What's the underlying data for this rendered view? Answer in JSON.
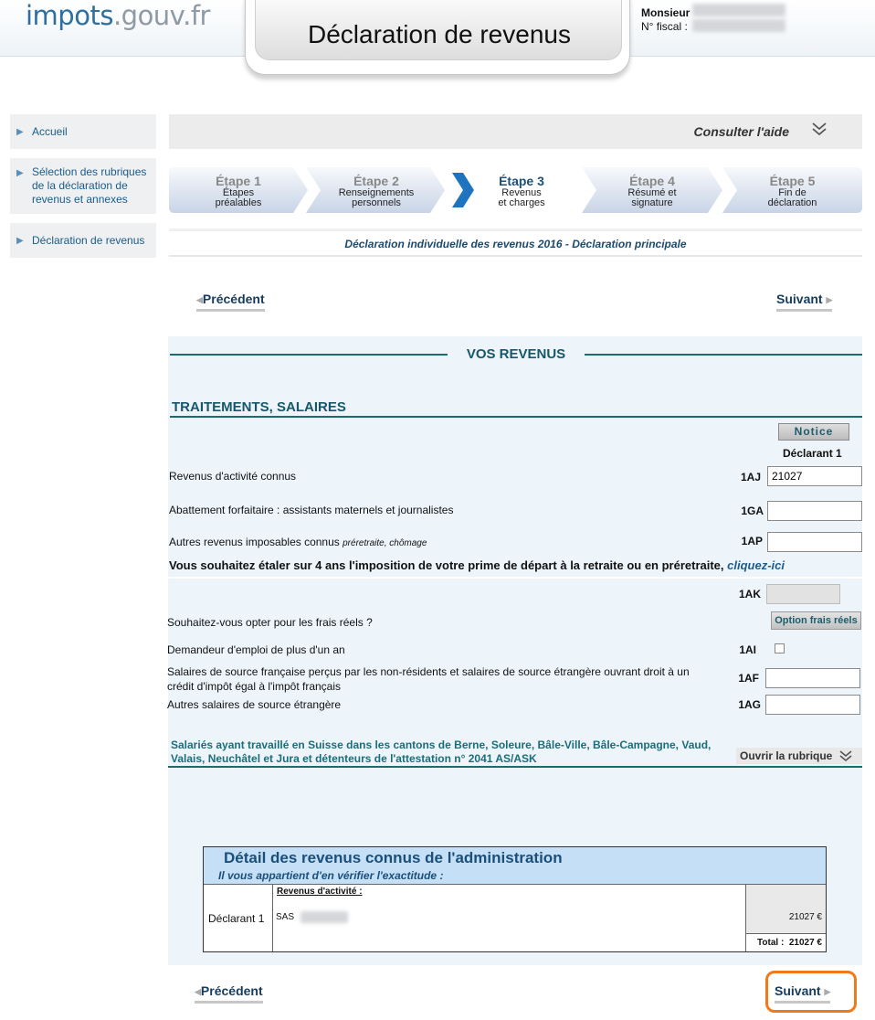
{
  "header": {
    "logo_part1": "impots",
    "logo_part2": ".gouv.fr",
    "page_title": "Déclaration de revenus",
    "user_title": "Monsieur",
    "fiscal_label": "N° fiscal :"
  },
  "sidebar": {
    "items": [
      {
        "label": "Accueil"
      },
      {
        "label": "Sélection des rubriques de la déclaration de revenus et annexes"
      },
      {
        "label": "Déclaration de revenus"
      }
    ]
  },
  "help": {
    "label": "Consulter l'aide",
    "icon": "double-chevron-down-icon"
  },
  "steps": [
    {
      "title": "Étape 1",
      "subtitle_line1": "Étapes",
      "subtitle_line2": "préalables"
    },
    {
      "title": "Étape 2",
      "subtitle_line1": "Renseignements",
      "subtitle_line2": "personnels"
    },
    {
      "title": "Étape 3",
      "subtitle_line1": "Revenus",
      "subtitle_line2": "et charges"
    },
    {
      "title": "Étape 4",
      "subtitle_line1": "Résumé et",
      "subtitle_line2": "signature"
    },
    {
      "title": "Étape 5",
      "subtitle_line1": "Fin de",
      "subtitle_line2": "déclaration"
    }
  ],
  "active_step": 3,
  "declaration_header": "Déclaration individuelle des revenus 2016 - Déclaration principale",
  "nav": {
    "prev": "Précédent",
    "next": "Suivant"
  },
  "revenus": {
    "section_title": "VOS REVENUS",
    "subsection_title": "TRAITEMENTS, SALAIRES",
    "notice_button": "Notice",
    "declarant_column": "Déclarant 1",
    "rows": [
      {
        "label": "Revenus d'activité connus",
        "code": "1AJ",
        "value": "21027"
      },
      {
        "label": "Abattement forfaitaire : assistants maternels et journalistes",
        "code": "1GA",
        "value": ""
      },
      {
        "label": "Autres revenus imposables connus",
        "label_note": "préretraite, chômage",
        "code": "1AP",
        "value": ""
      }
    ],
    "prime_question": "Vous souhaitez étaler sur 4 ans l'imposition de votre prime de départ à la retraite ou en préretraite,",
    "prime_link": "cliquez-ici",
    "code_1ak": "1AK",
    "frais_question": "Souhaitez-vous opter pour les frais réels ?",
    "frais_button": "Option frais réels",
    "emploi_label": "Demandeur d'emploi de plus d'un an",
    "code_1ai": "1AI",
    "source_fr_label_1": "Salaires de source française perçus par les non-résidents et salaires de source étrangère ouvrant droit à un",
    "source_fr_label_2": "crédit d'impôt égal à l'impôt français",
    "code_1af": "1AF",
    "autres_label": "Autres salaires de source étrangère",
    "code_1ag": "1AG",
    "suisse_text": "Salariés ayant travaillé en Suisse dans les cantons de Berne, Soleure, Bâle-Ville, Bâle-Campagne, Vaud, Valais, Neuchâtel et Jura et détenteurs de l'attestation n° 2041 AS/ASK",
    "ouvrir_label": "Ouvrir la rubrique"
  },
  "detail": {
    "title": "Détail des revenus connus de l'administration",
    "subtitle": "Il vous appartient d'en vérifier l'exactitude :",
    "declarant": "Déclarant 1",
    "revenus_heading": "Revenus d'activité :",
    "employer_prefix": "SAS",
    "amount": "21027 €",
    "total_label": "Total :",
    "total_amount": "21027 €"
  }
}
